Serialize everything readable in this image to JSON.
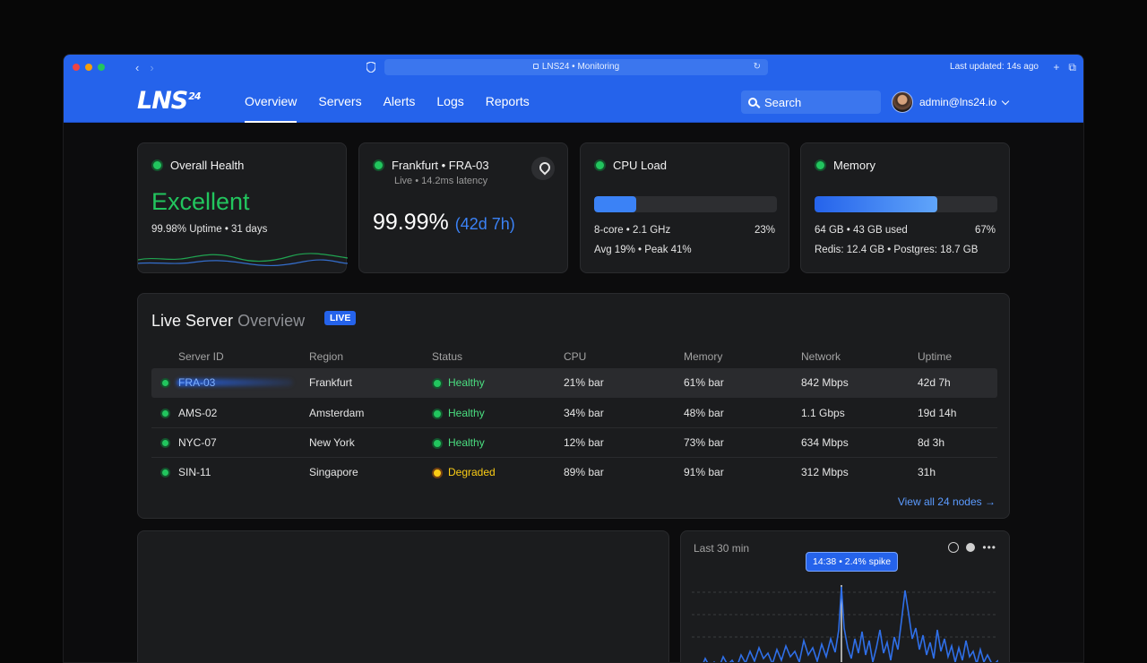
{
  "browser": {
    "url": "LNS24 • Monitoring",
    "last_updated": "Last updated: 14s ago",
    "dots": [
      "#ef4444",
      "#f59e0b",
      "#22c55e"
    ]
  },
  "header": {
    "logo": "LNS",
    "logo_sup": "24",
    "tabs": [
      "Overview",
      "Servers",
      "Alerts",
      "Logs",
      "Reports"
    ],
    "active_tab": "Overview",
    "search_placeholder": "Search",
    "user": "admin@lns24.io"
  },
  "cards": {
    "health": {
      "title": "Overall Health",
      "status": "Excellent",
      "sub": "99.98% Uptime • 31 days"
    },
    "location": {
      "title": "Frankfurt • FRA-03",
      "sub": "Live • 14.2ms latency",
      "uptime_pct": "99.99%",
      "uptime_dur": "(42d 7h)"
    },
    "cpu": {
      "title": "CPU Load",
      "fill_pct": 23,
      "info": "8-core • 2.1 GHz",
      "pct": "23%",
      "sub": "Avg 19% • Peak 41%"
    },
    "memory": {
      "title": "Memory",
      "fill_pct": 67,
      "info": "64 GB • 43 GB used",
      "pct": "67%",
      "sub": "Redis: 12.4 GB • Postgres: 18.7 GB"
    }
  },
  "overview": {
    "title": "Live Server",
    "title_muted": "Overview",
    "badge": "LIVE",
    "columns": [
      "Server ID",
      "Region",
      "Status",
      "CPU",
      "Memory",
      "Network",
      "Uptime"
    ],
    "rows": [
      {
        "id": "FRA-03",
        "region": "Frankfurt",
        "status": "Healthy",
        "cpu": "21% bar",
        "memory": "61% bar",
        "network": "842 Mbps",
        "uptime": "42d 7h"
      },
      {
        "id": "AMS-02",
        "region": "Amsterdam",
        "status": "Healthy",
        "cpu": "34% bar",
        "memory": "48% bar",
        "network": "1.1 Gbps",
        "uptime": "19d 14h"
      },
      {
        "id": "NYC-07",
        "region": "New York",
        "status": "Healthy",
        "cpu": "12% bar",
        "memory": "73% bar",
        "network": "634 Mbps",
        "uptime": "8d 3h"
      },
      {
        "id": "SIN-11",
        "region": "Singapore",
        "status": "Degraded",
        "cpu": "89% bar",
        "memory": "91% bar",
        "network": "312 Mbps",
        "uptime": "31h"
      }
    ],
    "view_all": "View all 24 nodes →"
  },
  "chart_panel": {
    "range_label": "Last 30 min",
    "tooltip": "14:38 • 2.4% spike"
  }
}
